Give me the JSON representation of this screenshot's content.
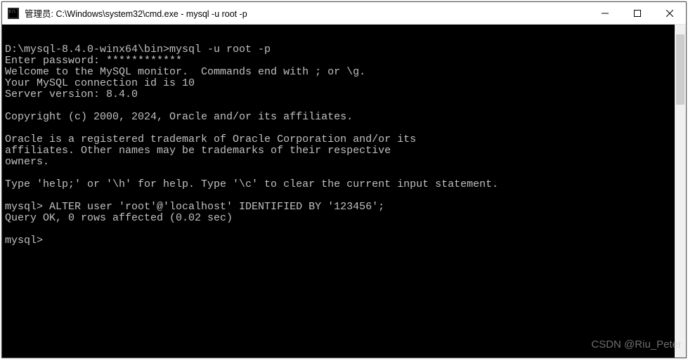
{
  "titlebar": {
    "title": "管理员: C:\\Windows\\system32\\cmd.exe - mysql  -u root -p"
  },
  "terminal": {
    "lines": [
      "",
      "D:\\mysql-8.4.0-winx64\\bin>mysql -u root -p",
      "Enter password: ************",
      "Welcome to the MySQL monitor.  Commands end with ; or \\g.",
      "Your MySQL connection id is 10",
      "Server version: 8.4.0",
      "",
      "Copyright (c) 2000, 2024, Oracle and/or its affiliates.",
      "",
      "Oracle is a registered trademark of Oracle Corporation and/or its",
      "affiliates. Other names may be trademarks of their respective",
      "owners.",
      "",
      "Type 'help;' or '\\h' for help. Type '\\c' to clear the current input statement.",
      "",
      "mysql> ALTER user 'root'@'localhost' IDENTIFIED BY '123456';",
      "Query OK, 0 rows affected (0.02 sec)",
      "",
      "mysql>"
    ]
  },
  "watermark": "CSDN @Riu_Peter"
}
